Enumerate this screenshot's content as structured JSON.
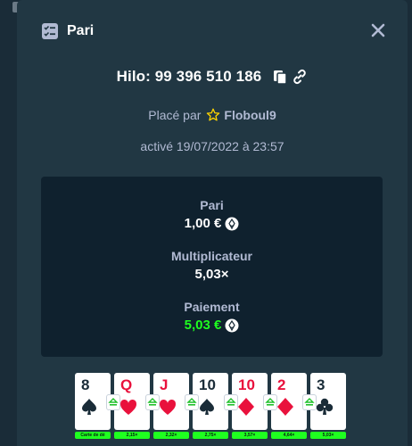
{
  "modal": {
    "title": "Pari",
    "title_icon": "bet-slip-icon",
    "close_icon": "close-icon"
  },
  "game": {
    "label": "Hilo: 99 396 510 186"
  },
  "placed": {
    "prefix": "Placé par",
    "username": "Floboul9"
  },
  "activated": "activé 19/07/2022 à 23:57",
  "stats": {
    "bet_label": "Pari",
    "bet_value": "1,00 €",
    "multiplier_label": "Multiplicateur",
    "multiplier_value": "5,03×",
    "payout_label": "Paiement",
    "payout_value": "5,03 €"
  },
  "colors": {
    "modal_bg": "#213743",
    "panel_bg": "#0f212e",
    "muted_text": "#b1bad3",
    "win_green": "#1fff20",
    "suit_red": "#e9113c"
  },
  "cards": [
    {
      "rank": "8",
      "suit": "spade",
      "color": "black",
      "badge": "Carte de dé"
    },
    {
      "rank": "Q",
      "suit": "heart",
      "color": "red",
      "badge": "2,15×"
    },
    {
      "rank": "J",
      "suit": "heart",
      "color": "red",
      "badge": "2,32×"
    },
    {
      "rank": "10",
      "suit": "spade",
      "color": "black",
      "badge": "2,75×"
    },
    {
      "rank": "10",
      "suit": "diamond",
      "color": "red",
      "badge": "3,57×"
    },
    {
      "rank": "2",
      "suit": "diamond",
      "color": "red",
      "badge": "4,64×"
    },
    {
      "rank": "3",
      "suit": "club",
      "color": "black",
      "badge": "5,03×"
    }
  ]
}
